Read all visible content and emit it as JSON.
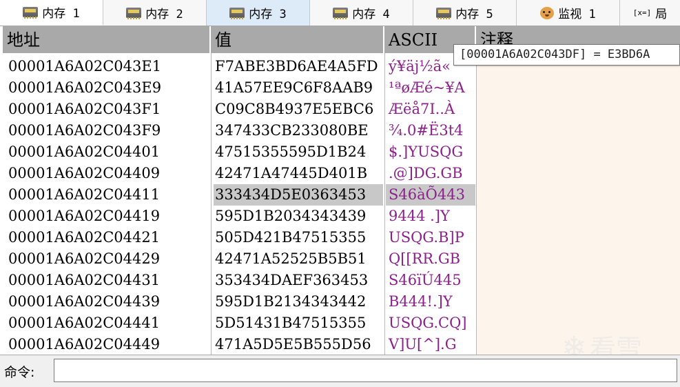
{
  "tabs": [
    {
      "label": "内存 1",
      "icon": "memory-icon"
    },
    {
      "label": "内存 2",
      "icon": "memory-icon"
    },
    {
      "label": "内存 3",
      "icon": "memory-icon"
    },
    {
      "label": "内存 4",
      "icon": "memory-icon"
    },
    {
      "label": "内存 5",
      "icon": "memory-icon"
    },
    {
      "label": "监视 1",
      "icon": "watch-icon"
    },
    {
      "label": "局",
      "icon": "variable-icon",
      "icon_text": "[x=]"
    }
  ],
  "columns": {
    "address": "地址",
    "value": "值",
    "ascii": "ASCII",
    "comment": "注释"
  },
  "tooltip": "[00001A6A02C043DF] = E3BD6A",
  "rows": [
    {
      "address": "00001A6A02C043E1",
      "value": "F7ABE3BD6AE4A5FD",
      "ascii": "ý¥äj½ã«"
    },
    {
      "address": "00001A6A02C043E9",
      "value": "41A57EE9C6F8AAB9",
      "ascii": "¹ªøÆé~¥A"
    },
    {
      "address": "00001A6A02C043F1",
      "value": "C09C8B4937E5EBC6",
      "ascii": "Æëå7I..À"
    },
    {
      "address": "00001A6A02C043F9",
      "value": "347433CB233080BE",
      "ascii": "¾.0#Ë3t4"
    },
    {
      "address": "00001A6A02C04401",
      "value": "47515355595D1B24",
      "ascii": "$.]YUSQG"
    },
    {
      "address": "00001A6A02C04409",
      "value": "42471A47445D401B",
      "ascii": ".@]DG.GB"
    },
    {
      "address": "00001A6A02C04411",
      "value": "333434D5E0363453",
      "ascii": "S46àÕ443"
    },
    {
      "address": "00001A6A02C04419",
      "value": "595D1B2034343439",
      "ascii": "9444 .]Y"
    },
    {
      "address": "00001A6A02C04421",
      "value": "505D421B47515355",
      "ascii": "USQG.B]P"
    },
    {
      "address": "00001A6A02C04429",
      "value": "42471A52525B5B51",
      "ascii": "Q[[RR.GB"
    },
    {
      "address": "00001A6A02C04431",
      "value": "353434DAEF363453",
      "ascii": "S46ïÚ445"
    },
    {
      "address": "00001A6A02C04439",
      "value": "595D1B2134343442",
      "ascii": "B444!.]Y"
    },
    {
      "address": "00001A6A02C04441",
      "value": "5D51431B47515355",
      "ascii": "USQG.CQ]"
    },
    {
      "address": "00001A6A02C04449",
      "value": "471A5D5E5B555D56",
      "ascii": "V]U[^].G"
    }
  ],
  "selected_row": 6,
  "command": {
    "label": "命令:",
    "value": ""
  },
  "watermark": "看雪"
}
